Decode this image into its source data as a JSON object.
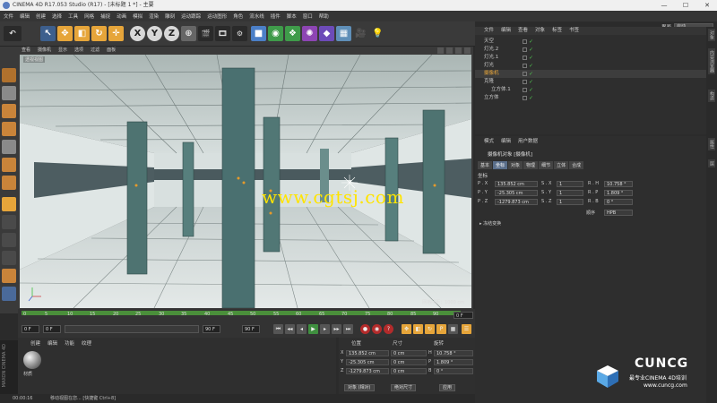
{
  "window": {
    "title": "CINEMA 4D R17.053 Studio (R17) - [未标题 1 *] - 主要",
    "controls": [
      "—",
      "☐",
      "✕"
    ]
  },
  "menubar": {
    "items": [
      "文件",
      "编辑",
      "创建",
      "选择",
      "工具",
      "网格",
      "捕捉",
      "动画",
      "模拟",
      "渲染",
      "雕刻",
      "运动跟踪",
      "运动图形",
      "角色",
      "流水线",
      "插件",
      "脚本",
      "窗口",
      "帮助"
    ],
    "layout_label": "界面",
    "layout_value": "启动"
  },
  "toolbar": {
    "axis_x": "X",
    "axis_y": "Y",
    "axis_z": "Z"
  },
  "viewport": {
    "menu": [
      "查看",
      "摄像机",
      "显示",
      "选项",
      "过滤",
      "面板"
    ],
    "label": "透视视图",
    "watermark": "www.cgtsj.com",
    "grid_label": "网格间距：1000 cm"
  },
  "timeline": {
    "ticks": [
      "0",
      "5",
      "10",
      "15",
      "20",
      "25",
      "30",
      "35",
      "40",
      "45",
      "50",
      "55",
      "60",
      "65",
      "70",
      "75",
      "80",
      "85",
      "90"
    ],
    "frame": "0 F"
  },
  "transport": {
    "start": "0 F",
    "current": "0 F",
    "end": "90 F",
    "max": "90 F"
  },
  "materials": {
    "menu": [
      "创建",
      "编辑",
      "功能",
      "纹理"
    ],
    "material_name": "材质"
  },
  "branding": {
    "maxon": "MAXON CINEMA 4D",
    "logo": "CUNCG",
    "tagline": "最专业CINEMA 4D培训",
    "url": "www.cuncg.com"
  },
  "coords": {
    "headers": [
      "位置",
      "尺寸",
      "旋转"
    ],
    "rows": [
      {
        "axis": "X",
        "pos": "135.852 cm",
        "size": "0 cm",
        "rot_axis": "H",
        "rot": "10.758 °"
      },
      {
        "axis": "Y",
        "pos": "-25.305 cm",
        "size": "0 cm",
        "rot_axis": "P",
        "rot": "1.809 °"
      },
      {
        "axis": "Z",
        "pos": "-1279.873 cm",
        "size": "0 cm",
        "rot_axis": "B",
        "rot": "0 °"
      }
    ],
    "mode_select": "对象 (相对)",
    "size_select": "绝对尺寸",
    "apply": "应用"
  },
  "status": {
    "time": "00:00:16",
    "message": "移动视图在您... [快捷键 Ctrl+8]"
  },
  "objects": {
    "menu": [
      "文件",
      "编辑",
      "查看",
      "对象",
      "标签",
      "书签"
    ],
    "items": [
      {
        "name": "天空",
        "indent": 0,
        "color": "#c8c8c8"
      },
      {
        "name": "灯光.2",
        "indent": 0,
        "color": "#c8c8c8"
      },
      {
        "name": "灯光.1",
        "indent": 0,
        "color": "#c8c8c8"
      },
      {
        "name": "灯光",
        "indent": 0,
        "color": "#c8c8c8"
      },
      {
        "name": "摄像机",
        "indent": 0,
        "color": "#e6a53a"
      },
      {
        "name": "克隆",
        "indent": 0,
        "color": "#c8c8c8"
      },
      {
        "name": "立方体.1",
        "indent": 1,
        "color": "#c8c8c8"
      },
      {
        "name": "立方体",
        "indent": 0,
        "color": "#c8c8c8"
      }
    ]
  },
  "attributes": {
    "menu": [
      "模式",
      "编辑",
      "用户数据"
    ],
    "title": "摄像机对象 [摄像机]",
    "tabs": [
      "基本",
      "坐标",
      "对象",
      "物理",
      "细节",
      "立体",
      "合成"
    ],
    "active_tab": "坐标",
    "section": "坐标",
    "rows": [
      {
        "p_label": "P . X",
        "p_val": "135.852 cm",
        "s_label": "S . X",
        "s_val": "1",
        "r_label": "R . H",
        "r_val": "10.758 °"
      },
      {
        "p_label": "P . Y",
        "p_val": "-25.305 cm",
        "s_label": "S . Y",
        "s_val": "1",
        "r_label": "R . P",
        "r_val": "1.809 °"
      },
      {
        "p_label": "P . Z",
        "p_val": "-1279.873 cm",
        "s_label": "S . Z",
        "s_val": "1",
        "r_label": "R . B",
        "r_val": "0 °"
      }
    ],
    "order_label": "顺序",
    "order_value": "HPB",
    "freeze": "▸ 冻结变换"
  },
  "right_tabs": [
    "对象",
    "内容浏览器",
    "构造",
    "属性",
    "层"
  ],
  "colors": {
    "accent": "#e6a53a",
    "timeline_green": "#4a8f3a",
    "watermark": "#ffe400"
  }
}
